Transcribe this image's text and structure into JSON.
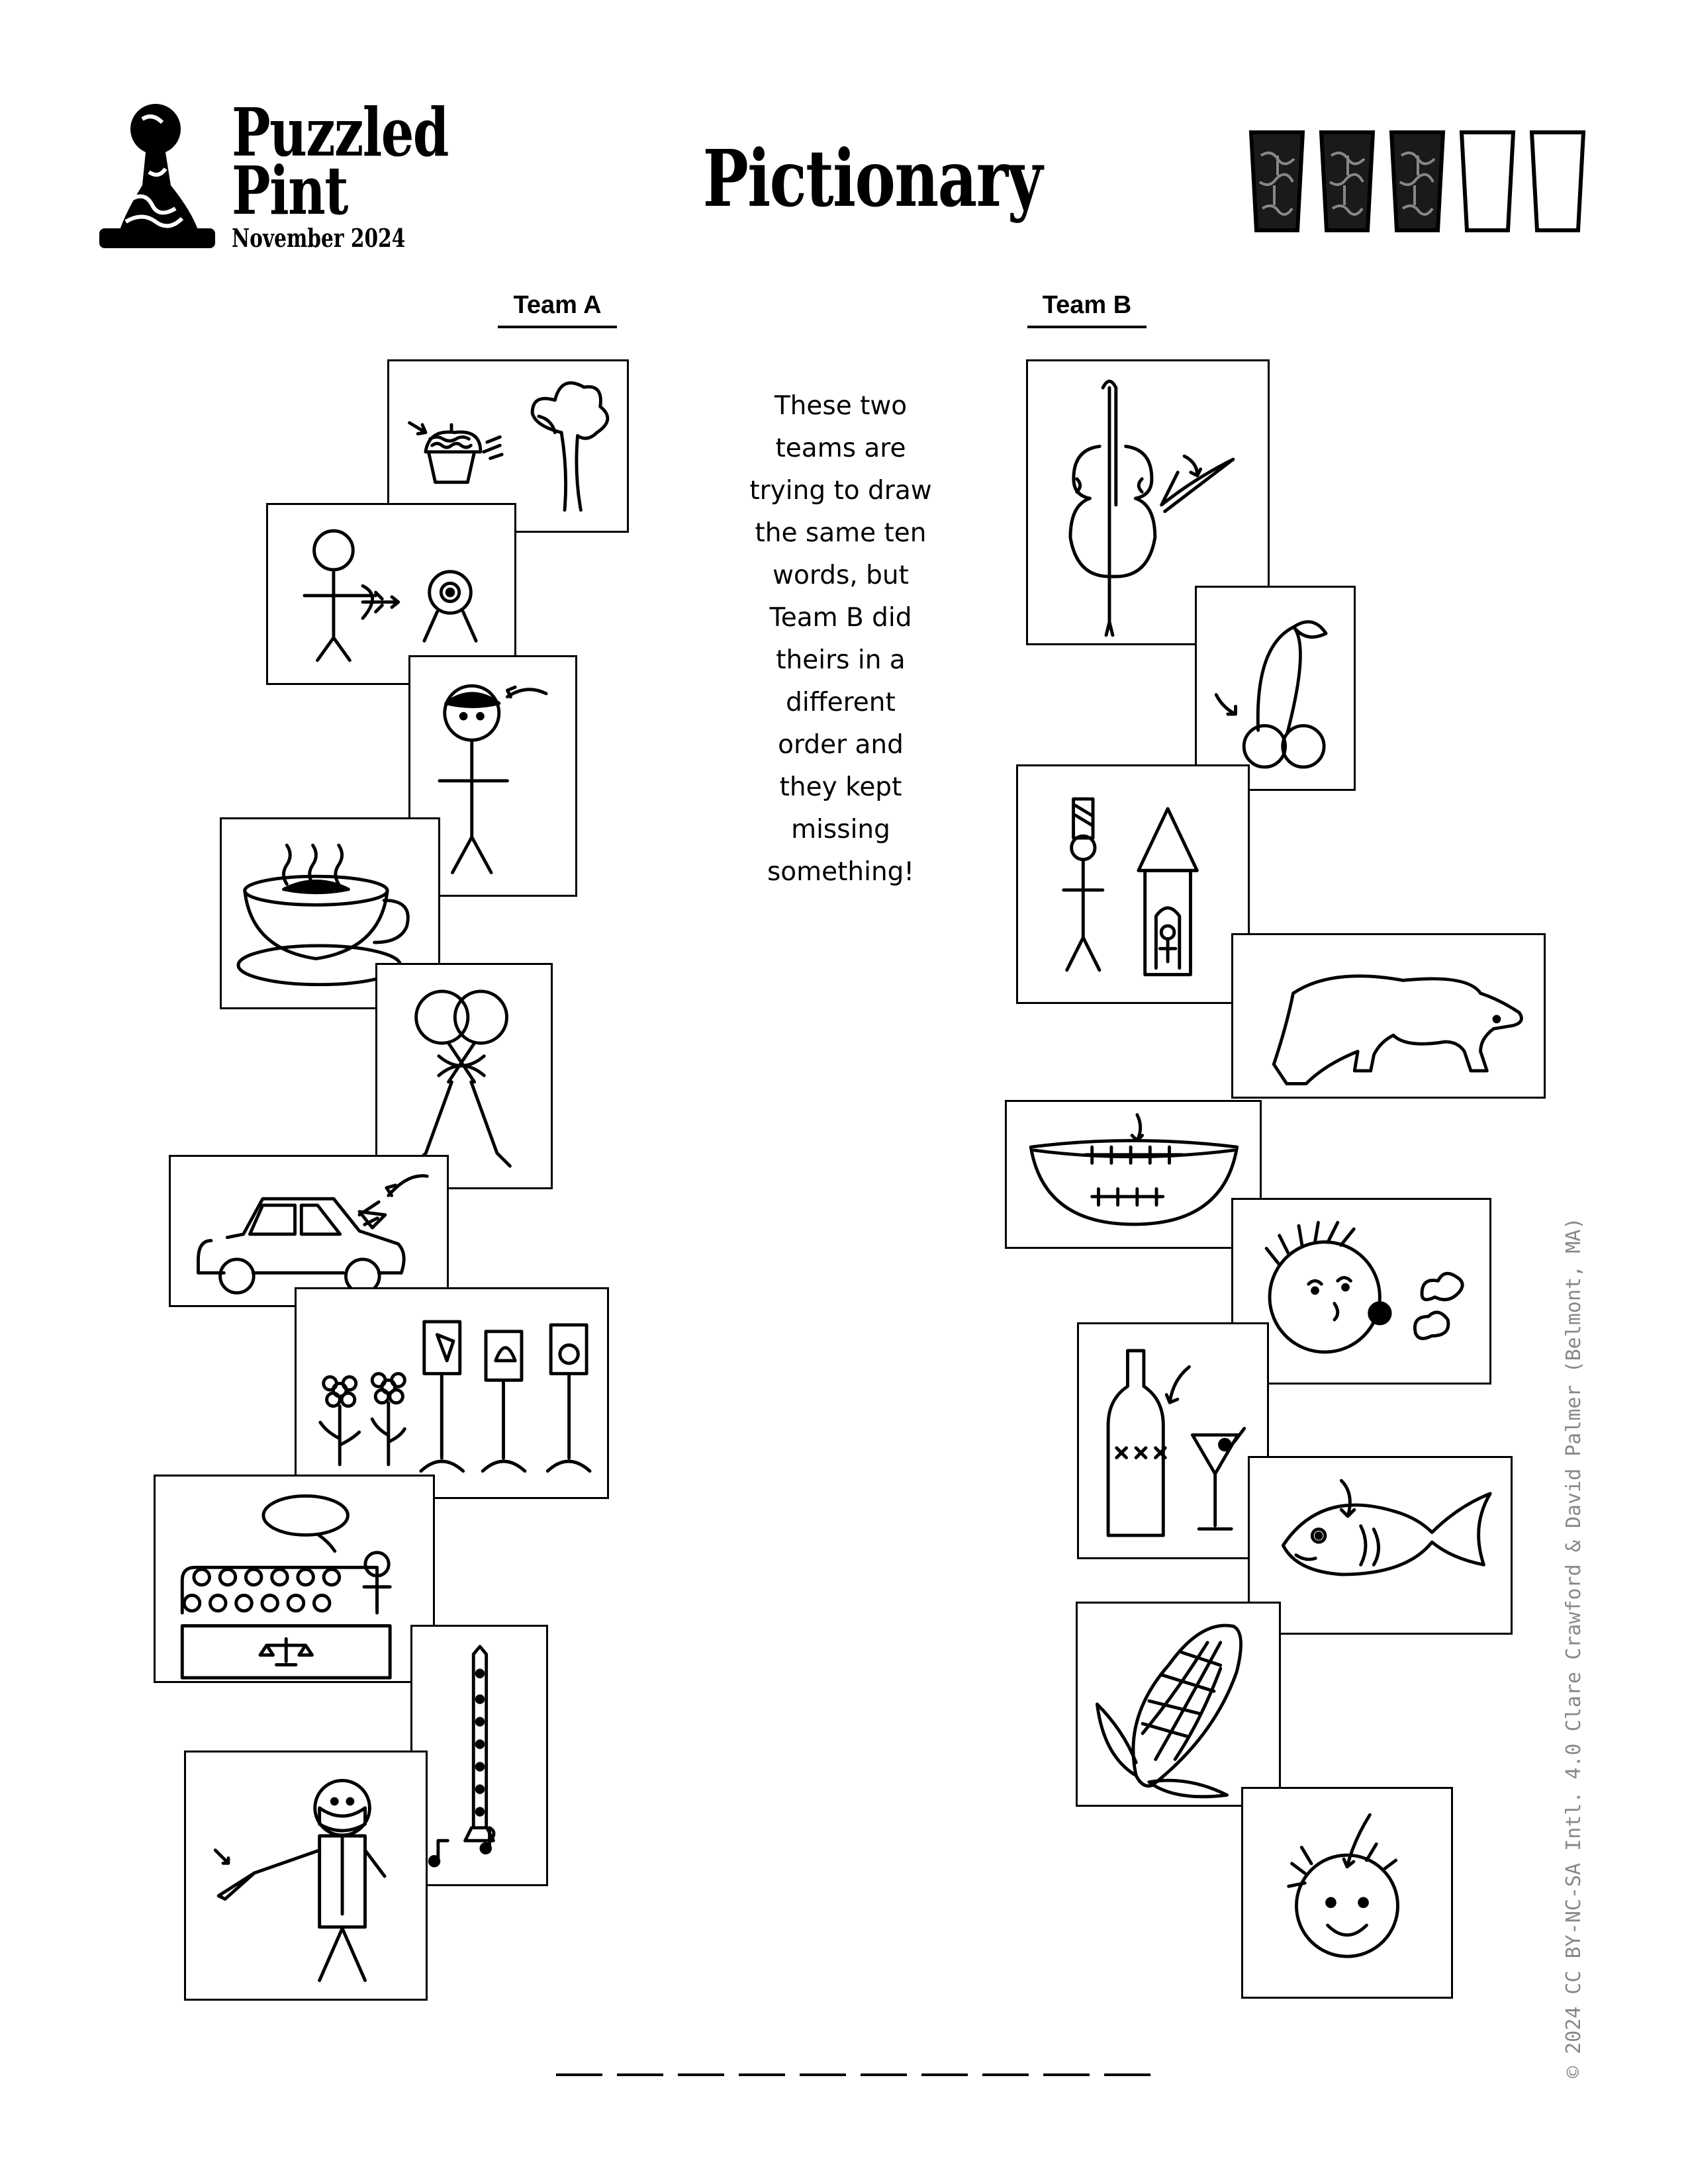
{
  "header": {
    "brand_line1": "Puzzled",
    "brand_line2": "Pint",
    "brand_date": "November 2024",
    "title": "Pictionary",
    "difficulty_filled": 3,
    "difficulty_total": 5
  },
  "teams": {
    "a_label": "Team A",
    "b_label": "Team B"
  },
  "flavor_lines": [
    "These two",
    "teams are",
    "trying to draw",
    "the same ten",
    "words, but",
    "Team B did",
    "theirs in a",
    "different",
    "order and",
    "they kept",
    "missing",
    "something!"
  ],
  "team_a_pictures": [
    "muffin-arrow-tree-icon",
    "archer-target-icon",
    "stick-figure-bandana-icon",
    "steaming-cup-icon",
    "hugging-figures-icon",
    "car-hood-icon",
    "flowers-and-signs-icon",
    "jury-courtroom-icon",
    "flute-notes-icon",
    "surgeon-scalpel-icon"
  ],
  "team_b_pictures": [
    "violin-bow-icon",
    "cherries-icon",
    "guard-tower-icon",
    "bear-icon",
    "braces-smile-icon",
    "face-sneeze-icon",
    "bottle-martini-icon",
    "fish-icon",
    "corn-icon",
    "smiling-face-hair-icon"
  ],
  "answer_blank_count": 10,
  "credit": "© 2024 CC BY-NC-SA Intl. 4.0   Clare Crawford & David Palmer (Belmont, MA)"
}
